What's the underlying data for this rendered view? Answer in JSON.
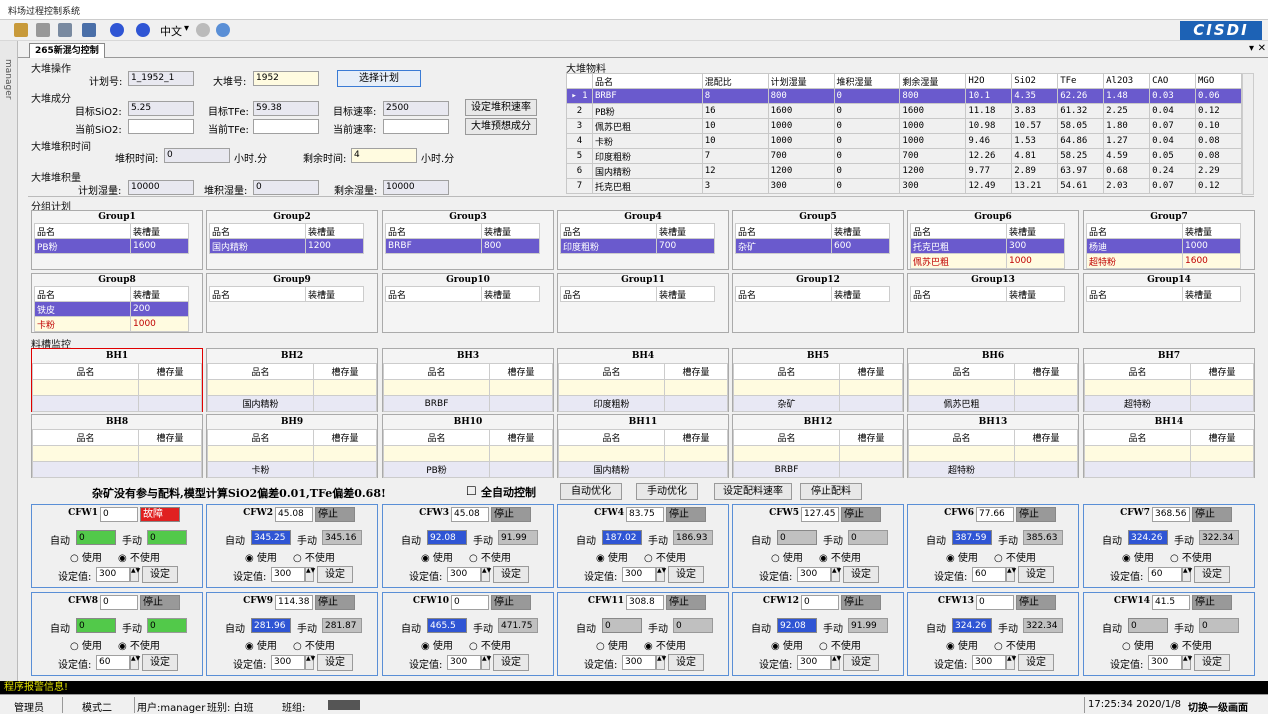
{
  "app": {
    "title": "料场过程控制系统",
    "lang": "中文",
    "logo": "CISDI",
    "tab": "265新混匀控制",
    "side_label": "manager"
  },
  "op": {
    "title": "大堆操作",
    "plan_label": "计划号:",
    "plan": "1_1952_1",
    "pile_label": "大堆号:",
    "pile": "1952",
    "select_btn": "选择计划"
  },
  "comp": {
    "title": "大堆成分",
    "t_sio2_l": "目标SiO2:",
    "t_sio2": "5.25",
    "t_tfe_l": "目标TFe:",
    "t_tfe": "59.38",
    "t_rate_l": "目标速率:",
    "t_rate": "2500",
    "set_rate_btn": "设定堆积速率",
    "c_sio2_l": "当前SiO2:",
    "c_tfe_l": "当前TFe:",
    "c_rate_l": "当前速率:",
    "predict_btn": "大堆预想成分"
  },
  "time": {
    "title": "大堆堆积时间",
    "stack_l": "堆积时间:",
    "stack": "0",
    "unit1": "小时.分",
    "remain_l": "剩余时间:",
    "remain": "4",
    "unit2": "小时.分"
  },
  "vol": {
    "title": "大堆堆积量",
    "plan_l": "计划湿量:",
    "plan": "10000",
    "stack_l": "堆积湿量:",
    "stack": "0",
    "remain_l": "剩余湿量:",
    "remain": "10000"
  },
  "mat": {
    "title": "大堆物料",
    "cols": [
      "",
      "品名",
      "混配比",
      "计划湿量",
      "堆积湿量",
      "剩余湿量",
      "H2O",
      "SiO2",
      "TFe",
      "Al2O3",
      "CAO",
      "MGO"
    ],
    "rows": [
      [
        "▸ 1",
        "BRBF",
        "8",
        "800",
        "0",
        "800",
        "10.1",
        "4.35",
        "62.26",
        "1.48",
        "0.03",
        "0.06"
      ],
      [
        "2",
        "PB粉",
        "16",
        "1600",
        "0",
        "1600",
        "11.18",
        "3.83",
        "61.32",
        "2.25",
        "0.04",
        "0.12"
      ],
      [
        "3",
        "佩苏巴粗",
        "10",
        "1000",
        "0",
        "1000",
        "10.98",
        "10.57",
        "58.05",
        "1.80",
        "0.07",
        "0.10"
      ],
      [
        "4",
        "卡粉",
        "10",
        "1000",
        "0",
        "1000",
        "9.46",
        "1.53",
        "64.86",
        "1.27",
        "0.04",
        "0.08"
      ],
      [
        "5",
        "印度粗粉",
        "7",
        "700",
        "0",
        "700",
        "12.26",
        "4.81",
        "58.25",
        "4.59",
        "0.05",
        "0.08"
      ],
      [
        "6",
        "国内精粉",
        "12",
        "1200",
        "0",
        "1200",
        "9.77",
        "2.89",
        "63.97",
        "0.68",
        "0.24",
        "2.29"
      ],
      [
        "7",
        "托克巴粗",
        "3",
        "300",
        "0",
        "300",
        "12.49",
        "13.21",
        "54.61",
        "2.03",
        "0.07",
        "0.12"
      ]
    ]
  },
  "group": {
    "title": "分组计划",
    "h1": "品名",
    "h2": "装槽量",
    "items": [
      {
        "name": "Group1",
        "rows": [
          [
            "PB粉",
            "1600"
          ]
        ]
      },
      {
        "name": "Group2",
        "rows": [
          [
            "国内精粉",
            "1200"
          ]
        ]
      },
      {
        "name": "Group3",
        "rows": [
          [
            "BRBF",
            "800"
          ]
        ]
      },
      {
        "name": "Group4",
        "rows": [
          [
            "印度粗粉",
            "700"
          ]
        ]
      },
      {
        "name": "Group5",
        "rows": [
          [
            "杂矿",
            "600"
          ]
        ]
      },
      {
        "name": "Group6",
        "rows": [
          [
            "托克巴粗",
            "300"
          ],
          [
            "佩苏巴粗",
            "1000"
          ]
        ]
      },
      {
        "name": "Group7",
        "rows": [
          [
            "杨迪",
            "1000"
          ],
          [
            "超特粉",
            "1600"
          ]
        ]
      },
      {
        "name": "Group8",
        "rows": [
          [
            "铁皮",
            "200"
          ],
          [
            "卡粉",
            "1000"
          ]
        ]
      },
      {
        "name": "Group9",
        "rows": []
      },
      {
        "name": "Group10",
        "rows": []
      },
      {
        "name": "Group11",
        "rows": []
      },
      {
        "name": "Group12",
        "rows": []
      },
      {
        "name": "Group13",
        "rows": []
      },
      {
        "name": "Group14",
        "rows": []
      }
    ]
  },
  "bin": {
    "title": "料槽监控",
    "h1": "品名",
    "h2": "槽存量",
    "items": [
      {
        "name": "BH1",
        "mat": ""
      },
      {
        "name": "BH2",
        "mat": "国内精粉"
      },
      {
        "name": "BH3",
        "mat": "BRBF"
      },
      {
        "name": "BH4",
        "mat": "印度粗粉"
      },
      {
        "name": "BH5",
        "mat": "杂矿"
      },
      {
        "name": "BH6",
        "mat": "佩苏巴粗"
      },
      {
        "name": "BH7",
        "mat": "超特粉"
      },
      {
        "name": "BH8",
        "mat": ""
      },
      {
        "name": "BH9",
        "mat": "卡粉"
      },
      {
        "name": "BH10",
        "mat": "PB粉"
      },
      {
        "name": "BH11",
        "mat": "国内精粉"
      },
      {
        "name": "BH12",
        "mat": "BRBF"
      },
      {
        "name": "BH13",
        "mat": "超特粉"
      },
      {
        "name": "BH14",
        "mat": ""
      }
    ]
  },
  "ctrl": {
    "msg": "杂矿没有参与配料,模型计算SiO2偏差0.01,TFe偏差0.68!",
    "auto_label": "全自动控制",
    "b1": "自动优化",
    "b2": "手动优化",
    "b3": "设定配料速率",
    "b4": "停止配料"
  },
  "cfw": {
    "auto": "自动",
    "manual": "手动",
    "use": "使用",
    "nouse": "不使用",
    "set_label": "设定值:",
    "set_btn": "设定",
    "items": [
      {
        "name": "CFW1",
        "v": "0",
        "st": "故障",
        "a": "0",
        "m": "0",
        "use": false,
        "sv": "300",
        "ac": "green",
        "mc": "green",
        "err": true
      },
      {
        "name": "CFW2",
        "v": "45.08",
        "st": "停止",
        "a": "345.25",
        "m": "345.16",
        "use": true,
        "sv": "300",
        "ac": "blue",
        "mc": "gray",
        "err": false
      },
      {
        "name": "CFW3",
        "v": "45.08",
        "st": "停止",
        "a": "92.08",
        "m": "91.99",
        "use": true,
        "sv": "300",
        "ac": "blue",
        "mc": "gray",
        "err": false
      },
      {
        "name": "CFW4",
        "v": "83.75",
        "st": "停止",
        "a": "187.02",
        "m": "186.93",
        "use": true,
        "sv": "300",
        "ac": "blue",
        "mc": "gray",
        "err": false
      },
      {
        "name": "CFW5",
        "v": "127.45",
        "st": "停止",
        "a": "0",
        "m": "0",
        "use": false,
        "sv": "300",
        "ac": "gray",
        "mc": "gray",
        "err": false
      },
      {
        "name": "CFW6",
        "v": "77.66",
        "st": "停止",
        "a": "387.59",
        "m": "385.63",
        "use": true,
        "sv": "60",
        "ac": "blue",
        "mc": "gray",
        "err": false
      },
      {
        "name": "CFW7",
        "v": "368.56",
        "st": "停止",
        "a": "324.26",
        "m": "322.34",
        "use": true,
        "sv": "60",
        "ac": "blue",
        "mc": "gray",
        "err": false
      },
      {
        "name": "CFW8",
        "v": "0",
        "st": "停止",
        "a": "0",
        "m": "0",
        "use": false,
        "sv": "60",
        "ac": "green",
        "mc": "green",
        "err": false
      },
      {
        "name": "CFW9",
        "v": "114.38",
        "st": "停止",
        "a": "281.96",
        "m": "281.87",
        "use": true,
        "sv": "300",
        "ac": "blue",
        "mc": "gray",
        "err": false
      },
      {
        "name": "CFW10",
        "v": "0",
        "st": "停止",
        "a": "465.5",
        "m": "471.75",
        "use": true,
        "sv": "300",
        "ac": "blue",
        "mc": "gray",
        "err": false
      },
      {
        "name": "CFW11",
        "v": "308.8",
        "st": "停止",
        "a": "0",
        "m": "0",
        "use": false,
        "sv": "300",
        "ac": "gray",
        "mc": "gray",
        "err": false
      },
      {
        "name": "CFW12",
        "v": "0",
        "st": "停止",
        "a": "92.08",
        "m": "91.99",
        "use": true,
        "sv": "300",
        "ac": "blue",
        "mc": "gray",
        "err": false
      },
      {
        "name": "CFW13",
        "v": "0",
        "st": "停止",
        "a": "324.26",
        "m": "322.34",
        "use": true,
        "sv": "300",
        "ac": "blue",
        "mc": "gray",
        "err": false
      },
      {
        "name": "CFW14",
        "v": "41.5",
        "st": "停止",
        "a": "0",
        "m": "0",
        "use": false,
        "sv": "300",
        "ac": "gray",
        "mc": "gray",
        "err": false
      }
    ]
  },
  "status": {
    "alarm": "程序报警信息!",
    "role": "管理员",
    "mode": "模式二",
    "user": "用户:manager",
    "shift": "班别: 白班",
    "team": "班组:",
    "time": "17:25:34 2020/1/8",
    "switch": "切换一级画面"
  }
}
